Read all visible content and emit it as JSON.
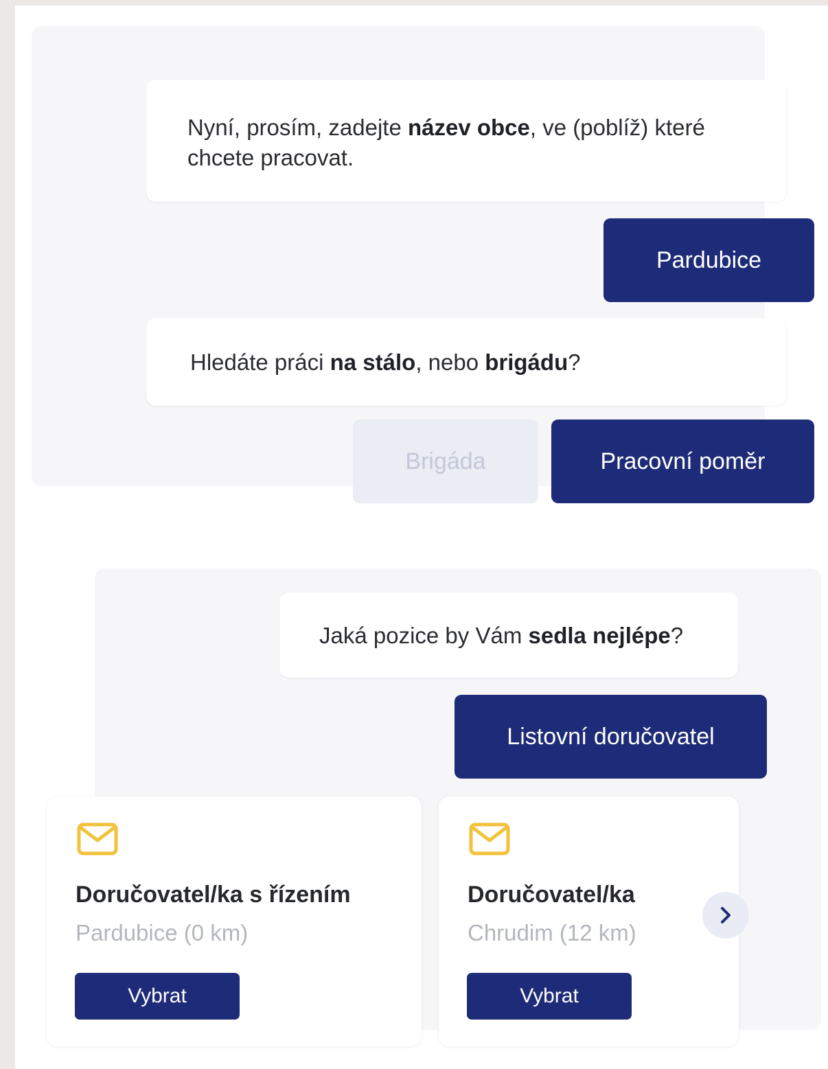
{
  "chat1": {
    "message1": {
      "prefix": "Nyní, prosím, zadejte ",
      "bold": "název obce",
      "suffix": ", ve (poblíž) které chcete pracovat."
    },
    "reply1": "Pardubice",
    "message2": {
      "prefix": "Hledáte práci ",
      "bold1": "na stálo",
      "middle": ", nebo ",
      "bold2": "brigádu",
      "suffix": "?"
    },
    "option_brigada": "Brigáda",
    "option_pracovni_pomer": "Pracovní poměr"
  },
  "chat2": {
    "message": {
      "prefix": "Jaká pozice by Vám ",
      "bold": "sedla nejlépe",
      "suffix": "?"
    },
    "reply": "Listovní doručovatel"
  },
  "job_cards": [
    {
      "icon": "mail-icon",
      "title": "Doručovatel/ka s řízením",
      "location": "Pardubice (0 km)",
      "button": "Vybrat"
    },
    {
      "icon": "mail-icon",
      "title": "Doručovatel/ka",
      "location": "Chrudim (12 km)",
      "button": "Vybrat"
    }
  ],
  "colors": {
    "primary": "#1e2b78",
    "icon_accent": "#f2c23a",
    "panel_bg": "#f6f6f8",
    "disabled_bg": "#ebedf5",
    "muted_text": "#b3b6bd"
  }
}
